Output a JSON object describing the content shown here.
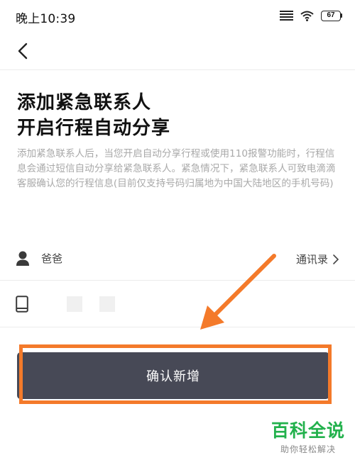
{
  "status_bar": {
    "time": "晚上10:39",
    "battery": "67",
    "icons": [
      "signal-icon",
      "wifi-icon",
      "battery-icon"
    ]
  },
  "nav": {
    "back_icon": "chevron-left-icon"
  },
  "page": {
    "title_line1": "添加紧急联系人",
    "title_line2": "开启行程自动分享",
    "description": "添加紧急联系人后，当您开启自动分享行程或使用110报警功能时，行程信息会通过短信自动分享给紧急联系人。紧急情况下，紧急联系人可致电滴滴客服确认您的行程信息(目前仅支持号码归属地为中国大陆地区的手机号码)"
  },
  "form": {
    "name_value": "爸爸",
    "name_icon": "person-icon",
    "contacts_label": "通讯录",
    "contacts_icon": "chevron-right-icon",
    "phone_icon": "phone-icon"
  },
  "confirm": {
    "label": "确认新增"
  },
  "annotation": {
    "color": "#f47a2a"
  },
  "watermark": {
    "main": "百科全说",
    "sub": "助你轻松解决",
    "color": "#22b14c"
  },
  "colors": {
    "button_bg": "#474956",
    "description_text": "#a9a9a9"
  }
}
